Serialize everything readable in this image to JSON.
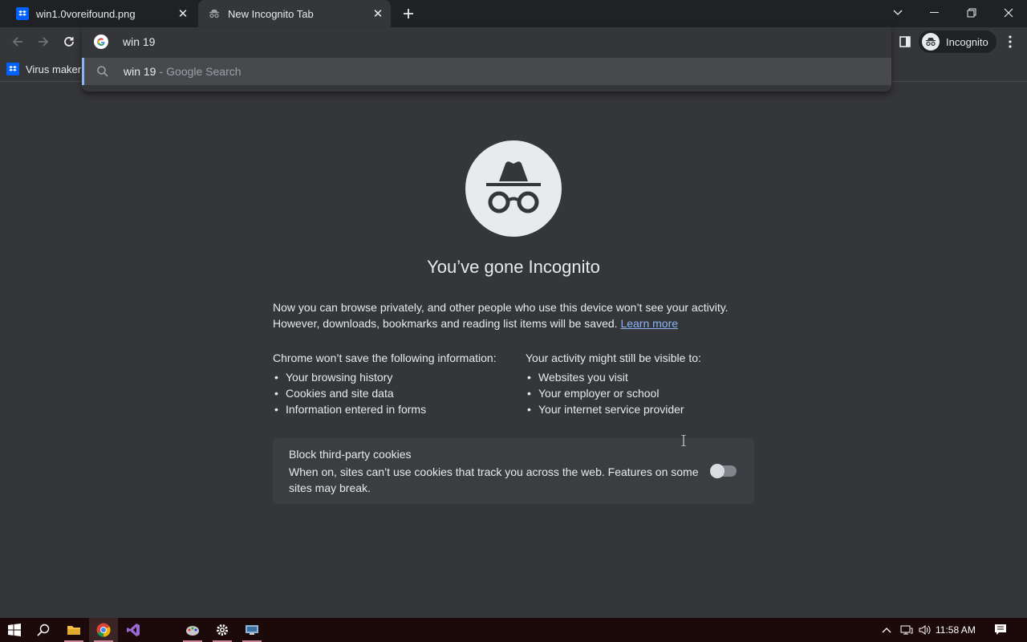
{
  "tabs": [
    {
      "title": "win1.0voreifound.png",
      "icon": "dropbox-icon"
    },
    {
      "title": "New Incognito Tab",
      "icon": "incognito-icon"
    }
  ],
  "omnibox": {
    "query": "win 19",
    "suggestion": {
      "query": "win 19",
      "separator": "-",
      "source": "Google Search"
    }
  },
  "profile": {
    "label": "Incognito"
  },
  "bookmarks": [
    {
      "label": "Virus maker",
      "icon": "dropbox-icon"
    }
  ],
  "page": {
    "headline": "You’ve gone Incognito",
    "intro": "Now you can browse privately, and other people who use this device won’t see your activity. However, downloads, bookmarks and reading list items will be saved.",
    "learn_more": "Learn more",
    "left_header": "Chrome won’t save the following information:",
    "left_items": [
      "Your browsing history",
      "Cookies and site data",
      "Information entered in forms"
    ],
    "right_header": "Your activity might still be visible to:",
    "right_items": [
      "Websites you visit",
      "Your employer or school",
      "Your internet service provider"
    ],
    "cookie_title": "Block third-party cookies",
    "cookie_desc": "When on, sites can’t use cookies that track you across the web. Features on some sites may break.",
    "cookie_toggle_on": false
  },
  "taskbar": {
    "clock": "11:58 AM",
    "apps": [
      "start-icon",
      "search-icon",
      "file-explorer-icon",
      "chrome-icon",
      "visual-studio-icon",
      "paint-icon",
      "settings-icon",
      "remote-desktop-icon"
    ]
  },
  "colors": {
    "accent": "#8ab4f8",
    "background": "#35363a",
    "tabstrip": "#202124"
  }
}
